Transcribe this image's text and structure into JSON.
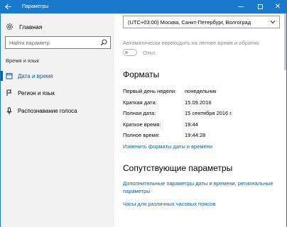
{
  "window": {
    "title": "Параметры"
  },
  "sidebar": {
    "home_label": "Главная",
    "search_placeholder": "Найти параметр",
    "section_label": "Время и язык",
    "items": [
      {
        "label": "Дата и время",
        "icon": "calendar-icon",
        "active": true
      },
      {
        "label": "Регион и язык",
        "icon": "language-icon",
        "active": false
      },
      {
        "label": "Распознавание голоса",
        "icon": "microphone-icon",
        "active": false
      }
    ]
  },
  "main": {
    "timezone_value": "(UTC+03:00) Москва, Санкт-Петербург, Волгоград",
    "dst_label": "Автоматически переходить на летнее время и обратно",
    "dst_toggle_label": "Откл.",
    "formats_heading": "Форматы",
    "formats": [
      {
        "label": "Первый день недели:",
        "value": "понедельник"
      },
      {
        "label": "Краткая дата:",
        "value": "15.09.2016"
      },
      {
        "label": "Полная дата:",
        "value": "15 сентября 2016 г."
      },
      {
        "label": "Краткое время:",
        "value": "19:44"
      },
      {
        "label": "Полное время:",
        "value": "19:44:28"
      }
    ],
    "change_formats_link": "Изменить форматы даты и времени",
    "related_heading": "Сопутствующие параметры",
    "related_link_1": "Дополнительные параметры даты и времени, региональные параметры",
    "related_link_2": "Часы для различных часовых поясов"
  },
  "colors": {
    "accent": "#1979ca",
    "link": "#0063b1",
    "sidebar_bg": "#f2f2f2"
  }
}
